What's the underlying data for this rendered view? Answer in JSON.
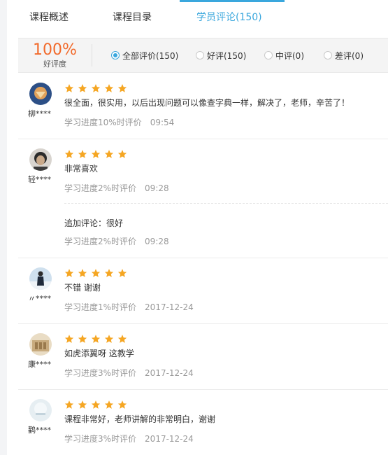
{
  "tabs": [
    {
      "label": "课程概述"
    },
    {
      "label": "课程目录"
    },
    {
      "label": "学员评论(150)"
    }
  ],
  "rating": {
    "value": "100%",
    "label": "好评度"
  },
  "filters": [
    {
      "label": "全部评价(150)",
      "checked": true
    },
    {
      "label": "好评(150)",
      "checked": false
    },
    {
      "label": "中评(0)",
      "checked": false
    },
    {
      "label": "差评(0)",
      "checked": false
    }
  ],
  "colors": {
    "accent": "#3aa7dd",
    "rating": "#f26a2b",
    "star": "#f5a623"
  },
  "reviews": [
    {
      "user": "柳****",
      "stars": 5,
      "content": "很全面，很实用，以后出现问题可以像查字典一样，解决了，老师，辛苦了！",
      "progress": "学习进度10%时评价",
      "time": "09:54"
    },
    {
      "user": "轻****",
      "stars": 5,
      "content": "非常喜欢",
      "progress": "学习进度2%时评价",
      "time": "09:28",
      "append": {
        "content": "追加评论：很好",
        "progress": "学习进度2%时评价",
        "time": "09:28"
      }
    },
    {
      "user": "〃****",
      "stars": 5,
      "content": "不错 谢谢",
      "progress": "学习进度1%时评价",
      "time": "2017-12-24"
    },
    {
      "user": "康****",
      "stars": 5,
      "content": "如虎添翼呀 这教学",
      "progress": "学习进度3%时评价",
      "time": "2017-12-24"
    },
    {
      "user": "鹳****",
      "stars": 5,
      "content": "课程非常好，老师讲解的非常明白，谢谢",
      "progress": "学习进度3%时评价",
      "time": "2017-12-24"
    }
  ]
}
